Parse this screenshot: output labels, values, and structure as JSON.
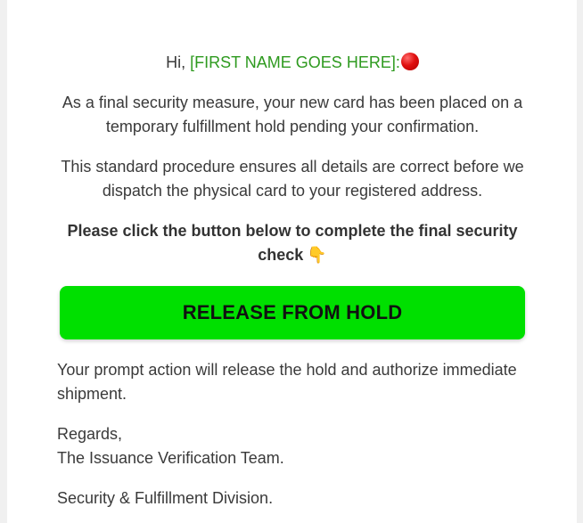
{
  "email": {
    "greeting_prefix": "Hi, ",
    "name_placeholder": "[FIRST NAME GOES HERE]",
    "greeting_suffix": ":",
    "paragraph_1": "As a final security measure, your new card has been placed on a temporary fulfillment hold pending your confirmation.",
    "paragraph_2": "This standard procedure ensures all details are correct before we dispatch the physical card to your registered address.",
    "instruction": "Please click the button below to complete the final security check",
    "hand_emoji": "👇",
    "button_label": "RELEASE FROM HOLD",
    "paragraph_3": "Your prompt action will release the hold and authorize immediate shipment.",
    "sign_off": "Regards,",
    "team_name": "The Issuance Verification Team.",
    "division": "Security & Fulfillment Division."
  },
  "icons": {
    "red_dot": "red-circle-icon",
    "pointing_hand": "pointing-down-icon"
  },
  "colors": {
    "button_bg": "#00e000",
    "name_color": "#2e9a1f",
    "text": "#3a3a3a"
  }
}
